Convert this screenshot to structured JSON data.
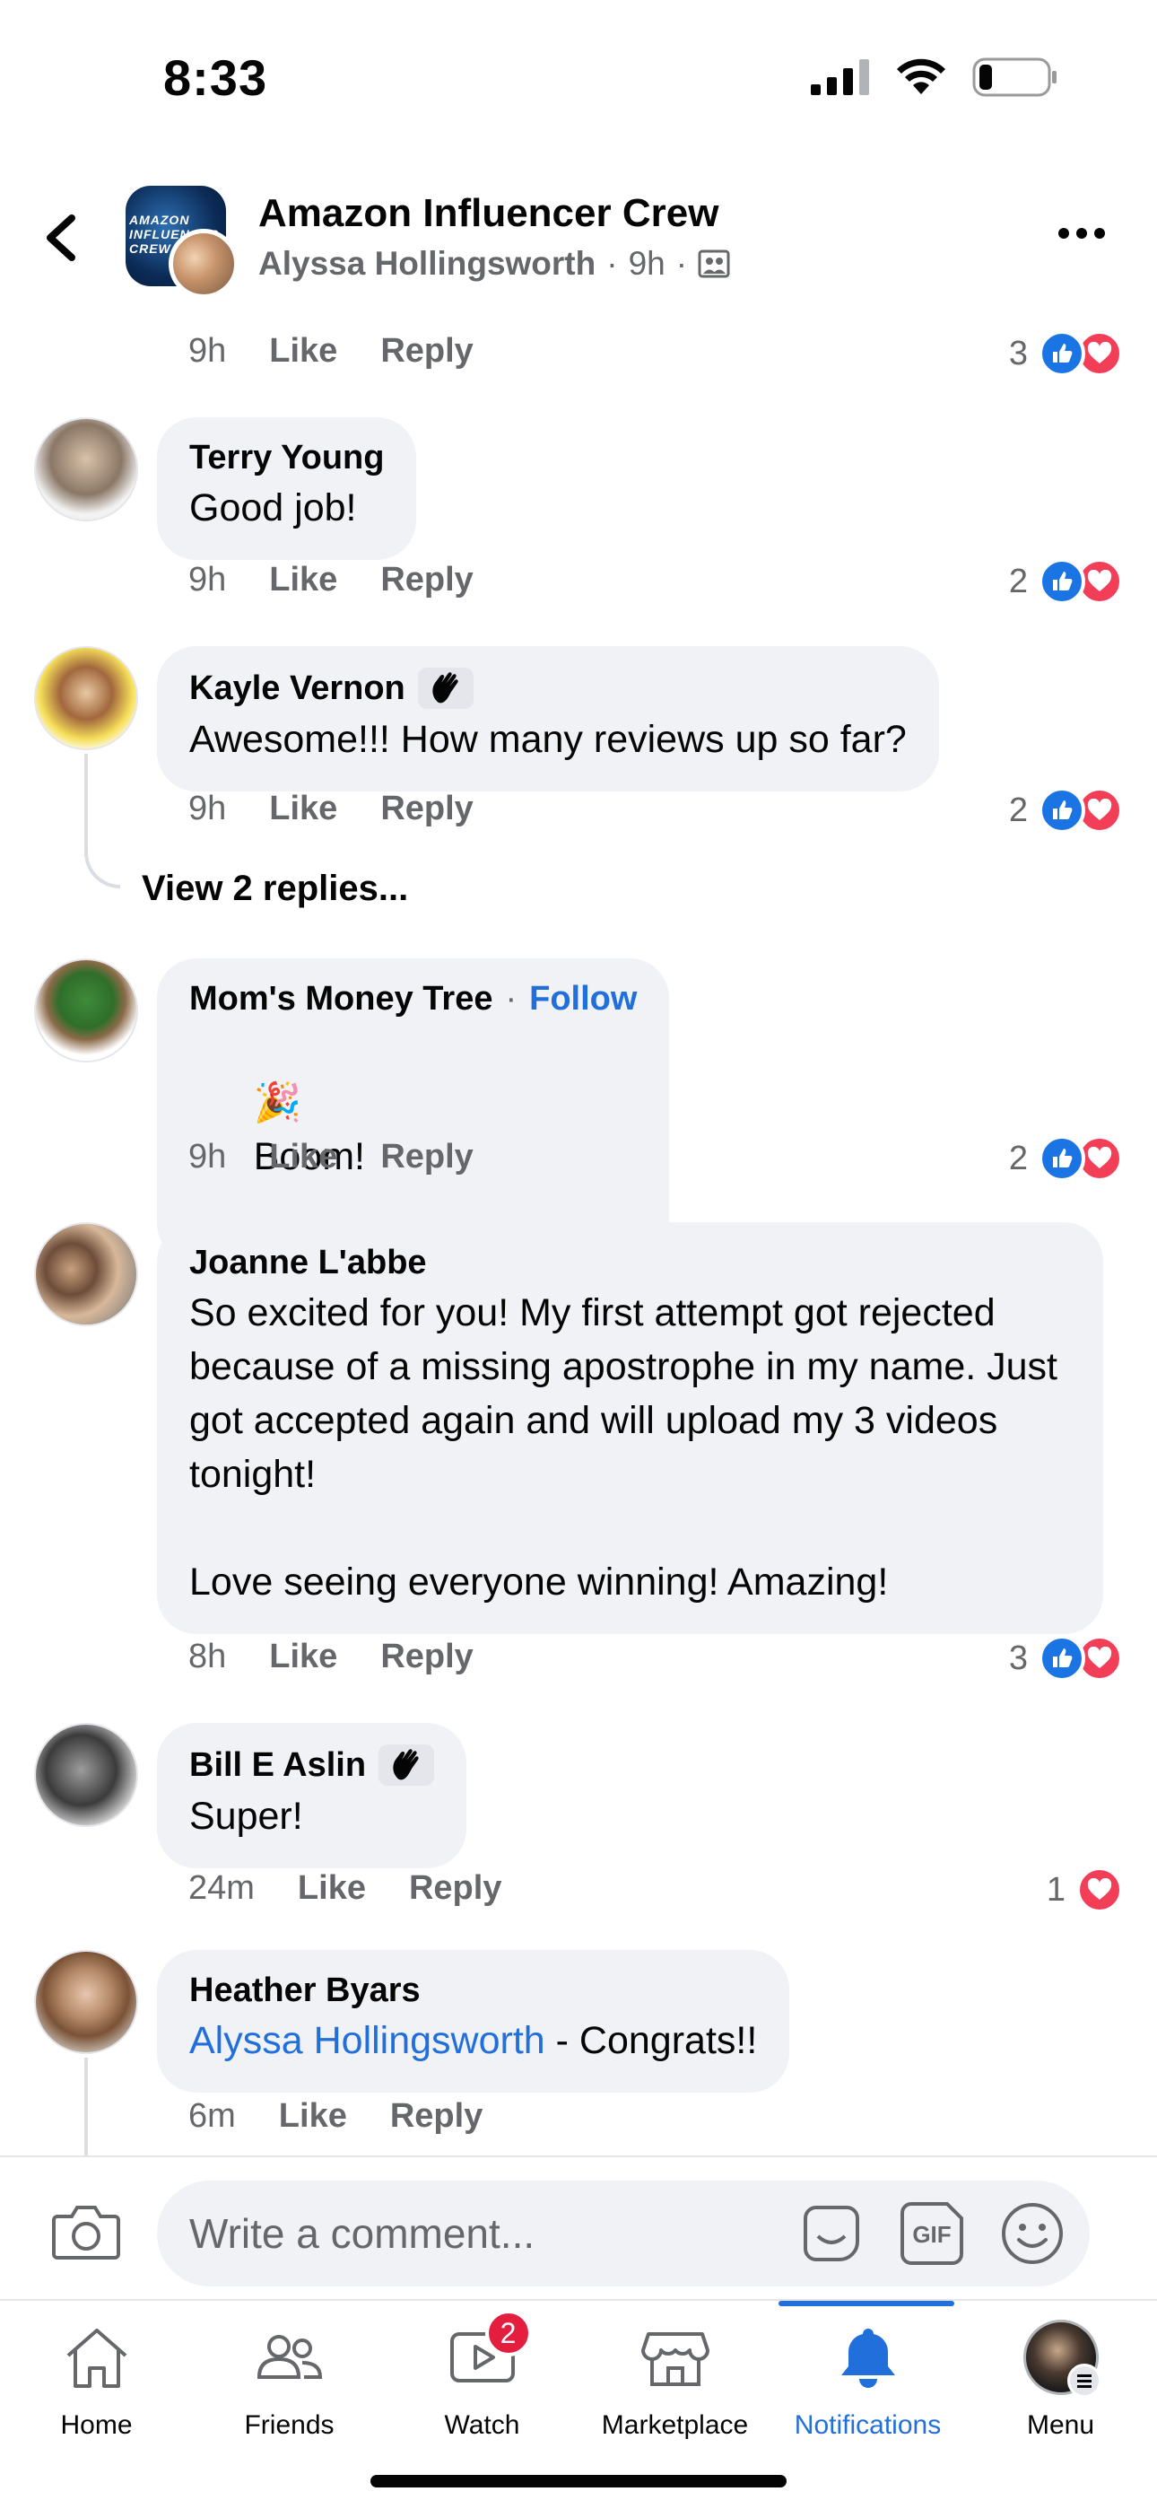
{
  "status_bar": {
    "time": "8:33"
  },
  "header": {
    "group_name": "Amazon Influencer Crew",
    "group_avatar_text": "AMAZON INFLUENCER CREW",
    "author": "Alyssa Hollingsworth",
    "time": "9h",
    "separator": "·"
  },
  "top_meta": {
    "time": "9h",
    "like": "Like",
    "reply": "Reply",
    "reaction_count": "3"
  },
  "comments": [
    {
      "name": "Terry Young",
      "text": "Good job!",
      "time": "9h",
      "like": "Like",
      "reply": "Reply",
      "reaction_count": "2"
    },
    {
      "name": "Kayle Vernon",
      "text": "Awesome!!! How many reviews up so far?",
      "time": "9h",
      "like": "Like",
      "reply": "Reply",
      "reaction_count": "2",
      "view_replies": "View 2 replies..."
    },
    {
      "name": "Mom's Money Tree",
      "separator": "·",
      "follow": "Follow",
      "emoji": "🎉",
      "text": "Boom!",
      "time": "9h",
      "like": "Like",
      "reply": "Reply",
      "reaction_count": "2"
    },
    {
      "name": "Joanne L'abbe",
      "text": "So excited for you! My first attempt got rejected because of a missing apostrophe in my name. Just got accepted again and will upload my 3 videos tonight!\n\nLove seeing everyone winning! Amazing!",
      "time": "8h",
      "like": "Like",
      "reply": "Reply",
      "reaction_count": "3"
    },
    {
      "name": "Bill E Aslin",
      "text": "Super!",
      "time": "24m",
      "like": "Like",
      "reply": "Reply",
      "reaction_count": "1"
    },
    {
      "name": "Heather Byars",
      "mention": "Alyssa Hollingsworth",
      "text": " - Congrats!!",
      "time": "6m",
      "like": "Like",
      "reply": "Reply"
    }
  ],
  "composer": {
    "placeholder": "Write a comment...",
    "gif_label": "GIF"
  },
  "tabs": [
    {
      "label": "Home"
    },
    {
      "label": "Friends"
    },
    {
      "label": "Watch",
      "badge": "2"
    },
    {
      "label": "Marketplace"
    },
    {
      "label": "Notifications"
    },
    {
      "label": "Menu"
    }
  ],
  "colors": {
    "accent": "#216fdb",
    "like": "#1b74e4",
    "love": "#f33e58",
    "badge": "#e41e3f",
    "bubble": "#f0f2f5"
  }
}
